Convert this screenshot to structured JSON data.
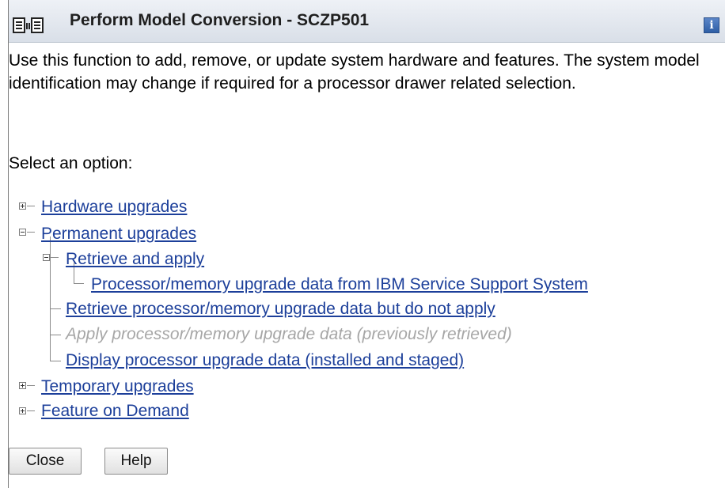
{
  "window": {
    "title": "Perform Model Conversion - SCZP501",
    "info_icon_label": "i"
  },
  "description": "Use this function to add, remove, or update system hardware and features. The system model identification may change if required for a processor drawer related selection.",
  "prompt": "Select an option:",
  "tree": {
    "hardware_upgrades": "Hardware upgrades",
    "permanent_upgrades": "Permanent upgrades",
    "retrieve_and_apply": "Retrieve and apply",
    "processor_memory_from_ibm": "Processor/memory upgrade data from IBM Service Support System",
    "retrieve_do_not_apply": "Retrieve processor/memory upgrade data but do not apply",
    "apply_previously_retrieved": "Apply processor/memory upgrade data (previously retrieved)",
    "display_processor_upgrade": "Display processor upgrade data (installed and staged)",
    "temporary_upgrades": "Temporary upgrades",
    "feature_on_demand": "Feature on Demand"
  },
  "buttons": {
    "close": "Close",
    "help": "Help"
  },
  "colors": {
    "link": "#1c3f9a",
    "disabled": "#a6a6a6",
    "titlebar": "#dfe4ec"
  },
  "icons": [
    "window-layout-icon",
    "info-icon",
    "expand-icon",
    "collapse-icon"
  ]
}
